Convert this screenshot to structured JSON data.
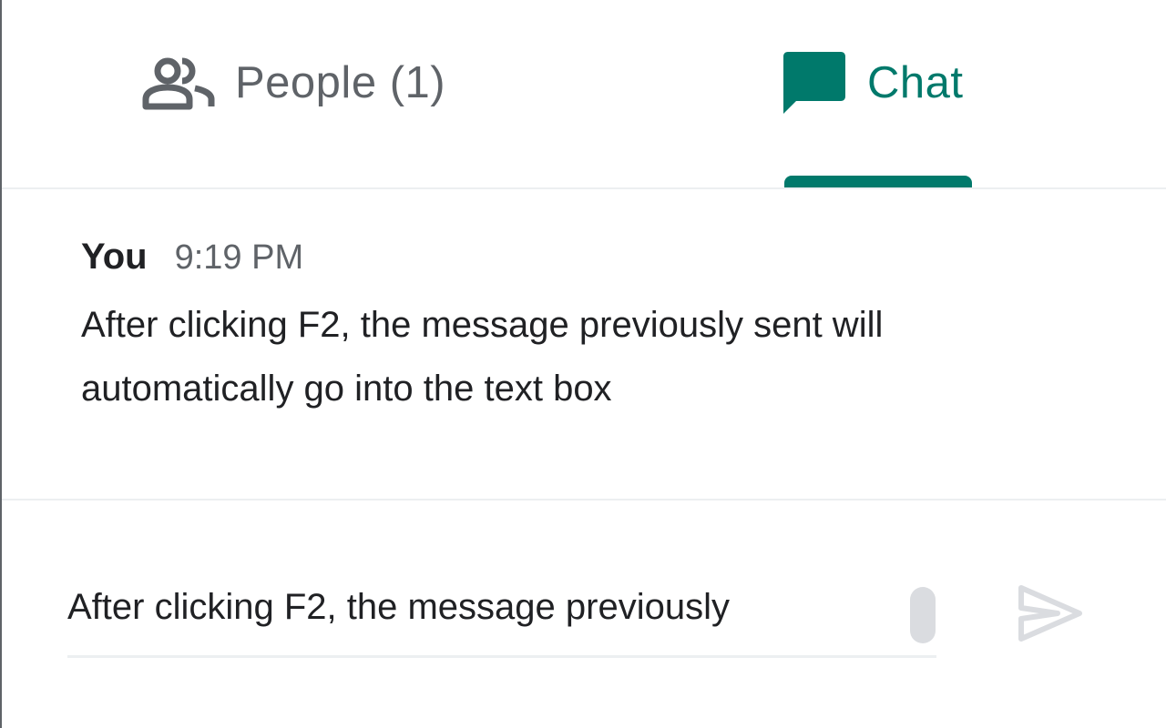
{
  "tabs": {
    "people": {
      "label": "People (1)",
      "icon": "people-icon"
    },
    "chat": {
      "label": "Chat",
      "icon": "chat-bubble-icon",
      "selected": true
    }
  },
  "messages": [
    {
      "sender": "You",
      "time": "9:19 PM",
      "text": "After clicking F2, the message previously sent will automatically go into the text box"
    }
  ],
  "composer": {
    "value": "After clicking F2, the message previously",
    "send_icon": "send-icon"
  },
  "colors": {
    "accent": "#00796b",
    "text_primary": "#202124",
    "text_secondary": "#5f6368",
    "divider": "#eceff1",
    "disabled": "#dadce0"
  }
}
